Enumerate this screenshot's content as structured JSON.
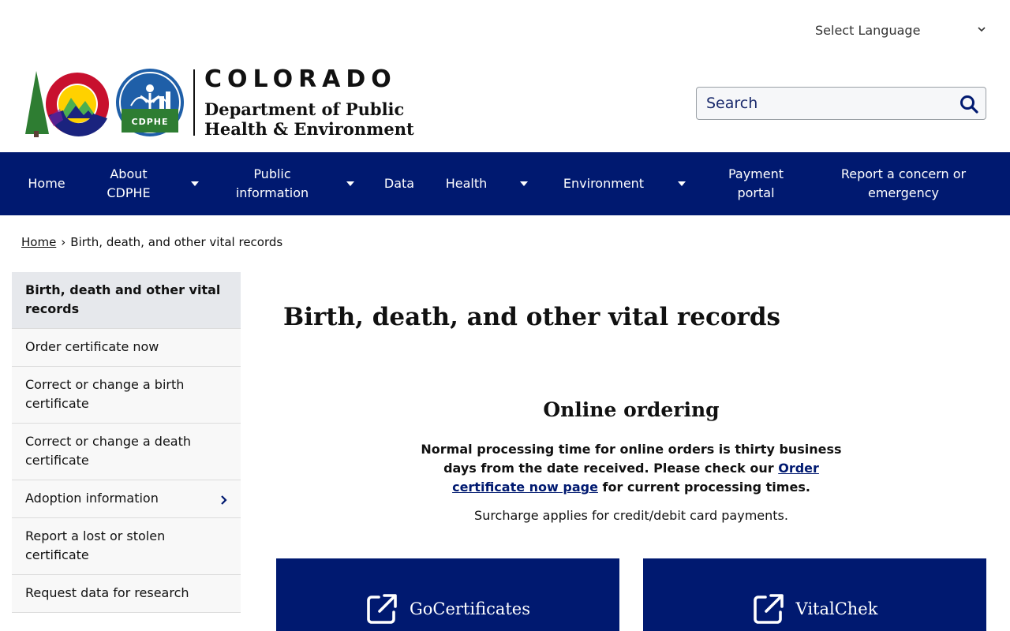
{
  "language": {
    "label": "Select Language"
  },
  "header": {
    "state": "COLORADO",
    "dept_line1": "Department of Public",
    "dept_line2": "Health & Environment",
    "seal_text": "CDPHE"
  },
  "search": {
    "placeholder": "Search"
  },
  "nav": {
    "items": [
      {
        "label": "Home"
      },
      {
        "label": "About CDPHE"
      },
      {
        "label": "Public information"
      },
      {
        "label": "Data"
      },
      {
        "label": "Health"
      },
      {
        "label": "Environment"
      },
      {
        "label": "Payment portal"
      },
      {
        "label": "Report a concern or emergency"
      }
    ]
  },
  "breadcrumb": {
    "home": "Home",
    "separator": "›",
    "current": "Birth, death, and other vital records"
  },
  "sidebar": {
    "items": [
      {
        "label": "Birth, death and other vital records"
      },
      {
        "label": "Order certificate now"
      },
      {
        "label": "Correct or change a birth certificate"
      },
      {
        "label": "Correct or change a death certificate"
      },
      {
        "label": "Adoption information"
      },
      {
        "label": "Report a lost or stolen certificate"
      },
      {
        "label": "Request data for research"
      }
    ]
  },
  "main": {
    "title": "Birth, death, and other vital records",
    "section_title": "Online ordering",
    "notice_before": "Normal processing time for online orders is thirty business days from the date received. Please check our ",
    "notice_link": "Order certificate now page",
    "notice_after": " for current processing times.",
    "surcharge": "Surcharge applies for credit/debit card payments.",
    "cards": [
      {
        "label": "GoCertificates",
        "icon": "external-link-icon"
      },
      {
        "label": "VitalChek",
        "icon": "external-link-icon"
      }
    ]
  },
  "colors": {
    "nav_bg": "#001970",
    "link": "#001970",
    "sidebar_active": "#e6e8ec"
  }
}
